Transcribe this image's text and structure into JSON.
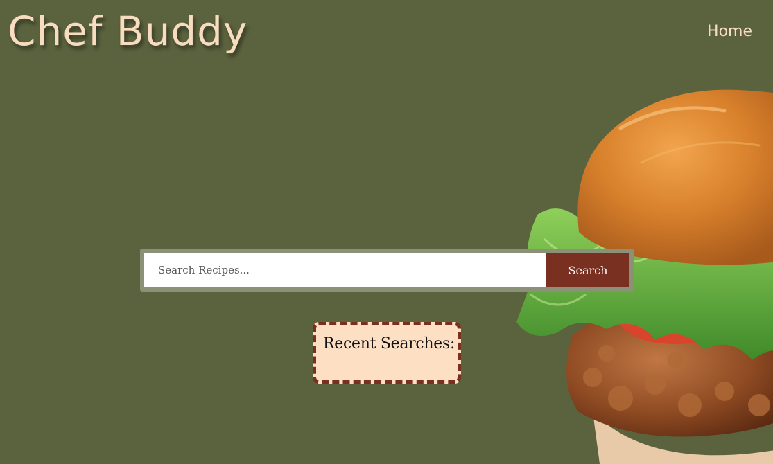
{
  "header": {
    "brand": "Chef Buddy",
    "nav": {
      "home_label": "Home"
    }
  },
  "search": {
    "placeholder": "Search Recipes...",
    "value": "",
    "button_label": "Search"
  },
  "recent": {
    "title": "Recent Searches:",
    "items": []
  },
  "hero": {
    "image": "burger-image"
  },
  "colors": {
    "background": "#5b633e",
    "brand_text": "#f8dcc0",
    "accent": "#7a3020",
    "recent_box_bg": "#fde0c4",
    "search_frame": "#8a9177"
  }
}
